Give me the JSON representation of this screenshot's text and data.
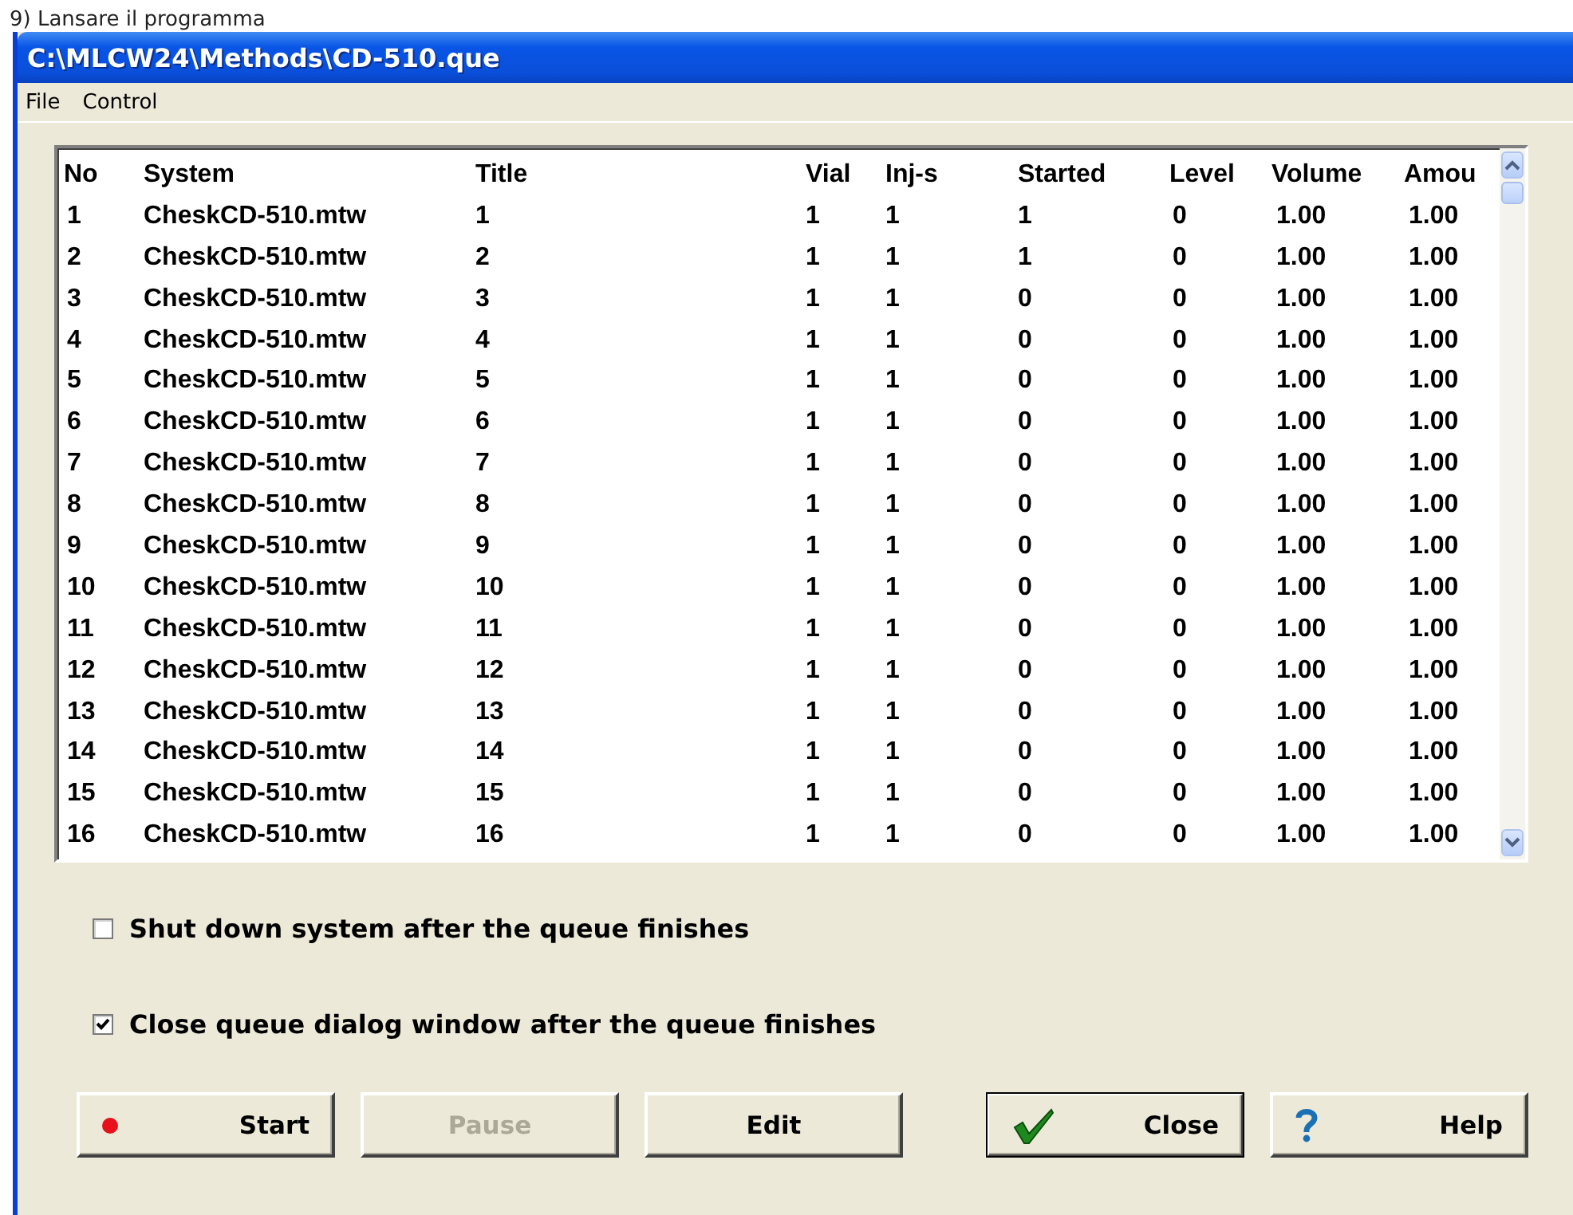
{
  "caption": "9) Lansare il programma",
  "window": {
    "title": "C:\\MLCW24\\Methods\\CD-510.que"
  },
  "menu": [
    "File",
    "Control"
  ],
  "table": {
    "columns": [
      "No",
      "System",
      "Title",
      "Vial",
      "Inj-s",
      "Started",
      "Level",
      "Volume",
      "Amou"
    ],
    "rows": [
      [
        "1",
        "CheskCD-510.mtw",
        "1",
        "1",
        "1",
        "1",
        "0",
        "1.00",
        "1.00"
      ],
      [
        "2",
        "CheskCD-510.mtw",
        "2",
        "1",
        "1",
        "1",
        "0",
        "1.00",
        "1.00"
      ],
      [
        "3",
        "CheskCD-510.mtw",
        "3",
        "1",
        "1",
        "0",
        "0",
        "1.00",
        "1.00"
      ],
      [
        "4",
        "CheskCD-510.mtw",
        "4",
        "1",
        "1",
        "0",
        "0",
        "1.00",
        "1.00"
      ],
      [
        "5",
        "CheskCD-510.mtw",
        "5",
        "1",
        "1",
        "0",
        "0",
        "1.00",
        "1.00"
      ],
      [
        "6",
        "CheskCD-510.mtw",
        "6",
        "1",
        "1",
        "0",
        "0",
        "1.00",
        "1.00"
      ],
      [
        "7",
        "CheskCD-510.mtw",
        "7",
        "1",
        "1",
        "0",
        "0",
        "1.00",
        "1.00"
      ],
      [
        "8",
        "CheskCD-510.mtw",
        "8",
        "1",
        "1",
        "0",
        "0",
        "1.00",
        "1.00"
      ],
      [
        "9",
        "CheskCD-510.mtw",
        "9",
        "1",
        "1",
        "0",
        "0",
        "1.00",
        "1.00"
      ],
      [
        "10",
        "CheskCD-510.mtw",
        "10",
        "1",
        "1",
        "0",
        "0",
        "1.00",
        "1.00"
      ],
      [
        "11",
        "CheskCD-510.mtw",
        "11",
        "1",
        "1",
        "0",
        "0",
        "1.00",
        "1.00"
      ],
      [
        "12",
        "CheskCD-510.mtw",
        "12",
        "1",
        "1",
        "0",
        "0",
        "1.00",
        "1.00"
      ],
      [
        "13",
        "CheskCD-510.mtw",
        "13",
        "1",
        "1",
        "0",
        "0",
        "1.00",
        "1.00"
      ],
      [
        "14",
        "CheskCD-510.mtw",
        "14",
        "1",
        "1",
        "0",
        "0",
        "1.00",
        "1.00"
      ],
      [
        "15",
        "CheskCD-510.mtw",
        "15",
        "1",
        "1",
        "0",
        "0",
        "1.00",
        "1.00"
      ],
      [
        "16",
        "CheskCD-510.mtw",
        "16",
        "1",
        "1",
        "0",
        "0",
        "1.00",
        "1.00"
      ]
    ]
  },
  "options": [
    {
      "label": "Shut down system after the queue finishes",
      "checked": false
    },
    {
      "label": "Close queue dialog window after the queue finishes",
      "checked": true
    }
  ],
  "buttons": [
    {
      "label": "Start",
      "kind": "dot",
      "disabled": false,
      "default": false
    },
    {
      "label": "Pause",
      "kind": "plain",
      "disabled": true,
      "default": false
    },
    {
      "label": "Edit",
      "kind": "plain",
      "disabled": false,
      "default": false
    },
    {
      "label": "Close",
      "kind": "check",
      "disabled": false,
      "default": true
    },
    {
      "label": "Help",
      "kind": "help",
      "disabled": false,
      "default": false
    }
  ]
}
